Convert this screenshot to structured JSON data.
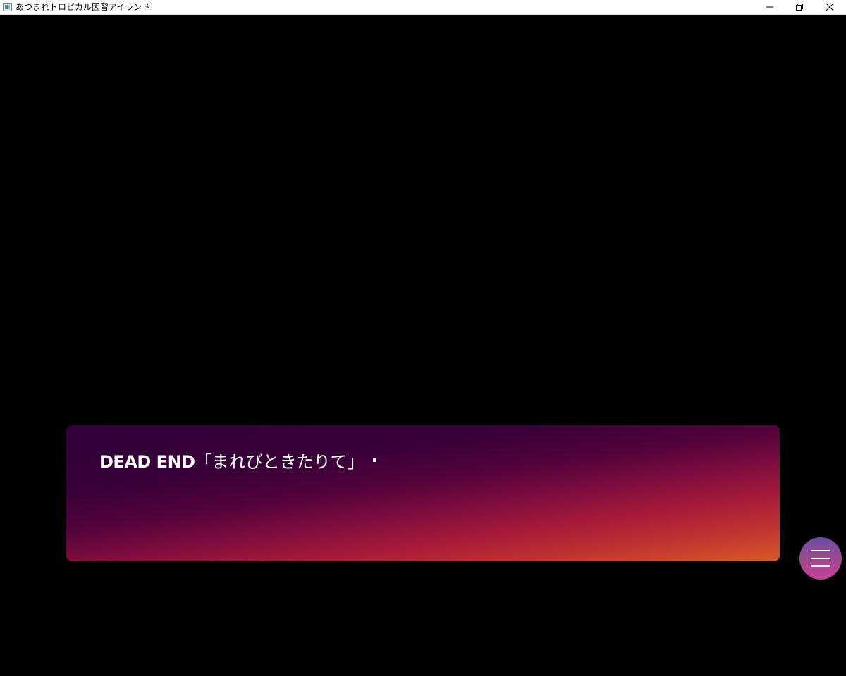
{
  "window": {
    "title": "あつまれトロピカル因習アイランド",
    "icon": "app-window-icon",
    "controls": {
      "minimize_icon": "minimize-icon",
      "maximize_icon": "restore-icon",
      "close_icon": "close-icon"
    }
  },
  "message_box": {
    "text_en": "DEAD END",
    "text_jp": "「まれびときたりて」",
    "colors": {
      "top": "#32003c",
      "middle": "#a71b3a",
      "bottom": "#d85a2a",
      "text": "#ffffff"
    }
  },
  "menu_button": {
    "icon": "hamburger-menu-icon",
    "colors": {
      "top": "#6a4fa3",
      "bottom": "#c8409a"
    }
  }
}
